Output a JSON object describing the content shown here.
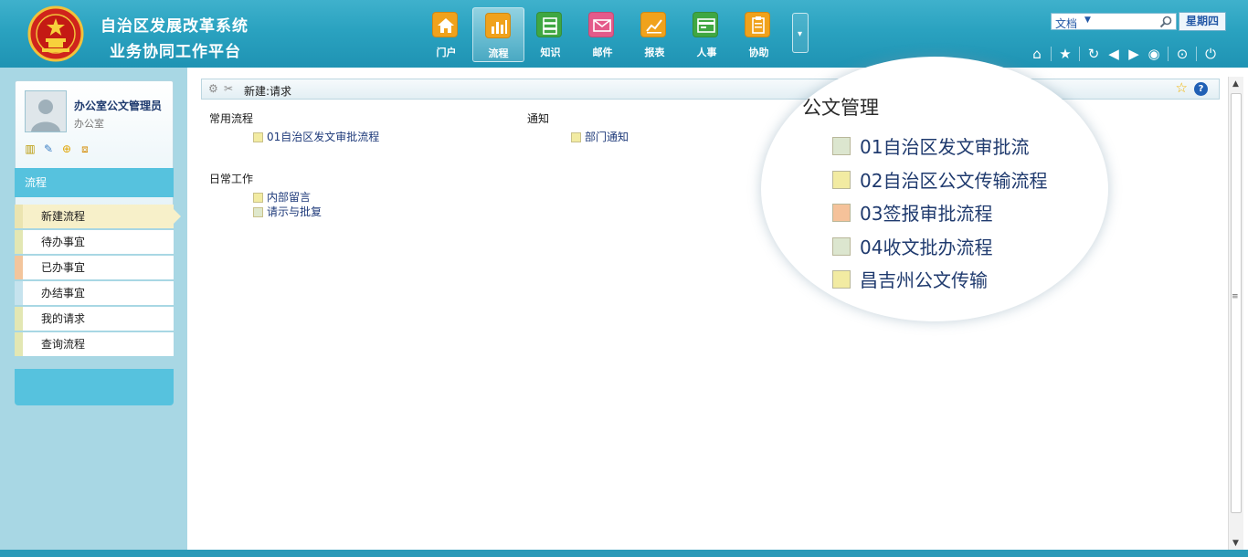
{
  "header": {
    "title_line1": "自治区发展改革系统",
    "title_line2": "业务协同工作平台",
    "nav": [
      {
        "label": "门户",
        "icon": "home-icon",
        "color": "#f0a21c"
      },
      {
        "label": "流程",
        "icon": "bar-chart-icon",
        "color": "#f0a21c"
      },
      {
        "label": "知识",
        "icon": "layers-icon",
        "color": "#3fa742"
      },
      {
        "label": "邮件",
        "icon": "mail-icon",
        "color": "#e45a8a"
      },
      {
        "label": "报表",
        "icon": "report-icon",
        "color": "#f0a21c"
      },
      {
        "label": "人事",
        "icon": "card-icon",
        "color": "#3fa742"
      },
      {
        "label": "协助",
        "icon": "clipboard-icon",
        "color": "#f0a21c"
      }
    ],
    "active_nav": "流程",
    "search": {
      "scope": "文档"
    },
    "weekday": "星期四"
  },
  "sidebar": {
    "user_name": "办公室公文管理员",
    "department": "办公室",
    "section_title": "流程",
    "menu": [
      {
        "label": "新建流程",
        "color": "#ebe4b0"
      },
      {
        "label": "待办事宜",
        "color": "#e3e7b3"
      },
      {
        "label": "已办事宜",
        "color": "#f3c59c"
      },
      {
        "label": "办结事宜",
        "color": "#c6e3ee"
      },
      {
        "label": "我的请求",
        "color": "#e3e7b3"
      },
      {
        "label": "查询流程",
        "color": "#e3e7b3"
      }
    ],
    "active_menu": "新建流程"
  },
  "main": {
    "breadcrumb": "新建:请求",
    "groups": [
      {
        "title": "常用流程",
        "items": [
          {
            "label": "01自治区发文审批流程",
            "color": "#f2eba2"
          }
        ]
      },
      {
        "title": "通知",
        "items": [
          {
            "label": "部门通知",
            "color": "#f2eba2"
          }
        ]
      },
      {
        "title": "日常工作",
        "items": [
          {
            "label": "内部留言",
            "color": "#f2eba2"
          },
          {
            "label": "请示与批复",
            "color": "#dfe8cc"
          }
        ]
      }
    ],
    "magnifier": {
      "title": "公文管理",
      "items": [
        {
          "label": "01自治区发文审批流",
          "color": "#dce6cf"
        },
        {
          "label": "02自治区公文传输流程",
          "color": "#f2eba2"
        },
        {
          "label": "03签报审批流程",
          "color": "#f5c29a"
        },
        {
          "label": "04收文批办流程",
          "color": "#dce6cf"
        },
        {
          "label": "昌吉州公文传输",
          "color": "#f2eba2"
        }
      ]
    }
  }
}
